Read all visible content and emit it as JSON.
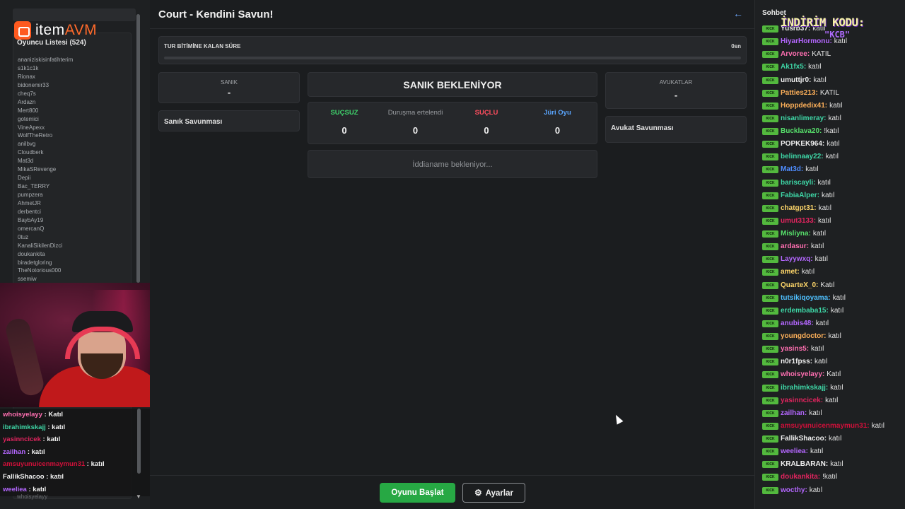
{
  "sidebar": {
    "logo_prefix": "item",
    "logo_suffix": "AVM",
    "player_list_title": "Oyuncu Listesi (524)",
    "players": [
      "ananiziskisinfatihterim",
      "s1k1c1k",
      "Rionax",
      "bidonemir33",
      "cheq7s",
      "Ardazn",
      "Mert800",
      "gotemici",
      "VineApexx",
      "WolfTheRetro",
      "anilbvg",
      "Cloudberk",
      "Mat3d",
      "MikaSRevenge",
      "Depii",
      "Bac_TERRY",
      "pumpzera",
      "AhmetJR",
      "derbentci",
      "BaybAy19",
      "omercanQ",
      "0tuz",
      "KanaliSikilenDizci",
      "doukankita",
      "biradetgloring",
      "TheNotorious000",
      "ssemiw"
    ]
  },
  "overlay_chat": {
    "rows": [
      {
        "user": "whoisyelayy",
        "color": "#ff6fb1",
        "msg": " : Katıl"
      },
      {
        "user": "ibrahimkskajj",
        "color": "#3ed6a6",
        "msg": " : katıl"
      },
      {
        "user": "yasinncicek",
        "color": "#e0245e",
        "msg": " : katıl"
      },
      {
        "user": "zailhan",
        "color": "#b467ff",
        "msg": " : katıl"
      },
      {
        "user": "amsuyunuicenmaymun31",
        "color": "#d0103a",
        "msg": " : katıl"
      },
      {
        "user": "FallikShacoo",
        "color": "#f3f3f3",
        "msg": " : katıl"
      },
      {
        "user": "weeliea",
        "color": "#b467ff",
        "msg": " : katıl"
      }
    ],
    "ghost_bottom": "whoisyelayy"
  },
  "main": {
    "title": "Court - Kendini Savun!",
    "timer_label": "TUR BİTİMİNE KALAN SÜRE",
    "timer_value": "0sn",
    "timer_progress": 0,
    "defendant_label": "SANIK",
    "defendant_value": "-",
    "defendant_defense": "Sanık Savunması",
    "status": "SANIK BEKLENİYOR",
    "votes": [
      {
        "label": "SUÇSUZ",
        "value": "0",
        "color": "#3fd16b"
      },
      {
        "label": "Duruşma ertelendi",
        "value": "0",
        "color": "#9a9da1"
      },
      {
        "label": "SUÇLU",
        "value": "0",
        "color": "#ff4d5e"
      },
      {
        "label": "Jüri Oyu",
        "value": "0",
        "color": "#5aa6ff"
      }
    ],
    "indictment_placeholder": "İddianame bekleniyor...",
    "lawyers_label": "AVUKATLAR",
    "lawyers_value": "-",
    "lawyer_defense": "Avukat Savunması",
    "start_button": "Oyunu Başlat",
    "settings_button": "Ayarlar"
  },
  "chat": {
    "title": "Sohbet",
    "badge": "KICK",
    "promo_line1": "İNDİRİM KODU:",
    "promo_line2": "\"KCB\"",
    "messages": [
      {
        "user": "Yusrb37",
        "color": "#f0f0f0",
        "text": "katıl"
      },
      {
        "user": "HiyarHormonu",
        "color": "#b467ff",
        "text": "katıl"
      },
      {
        "user": "Arvoree",
        "color": "#ff6fb1",
        "text": "KATIL"
      },
      {
        "user": "Ak1fx5",
        "color": "#3ed6a6",
        "text": "katıl"
      },
      {
        "user": "umuttjr0",
        "color": "#f0f0f0",
        "text": "katıl"
      },
      {
        "user": "Patties213",
        "color": "#ffb15a",
        "text": "KATIL"
      },
      {
        "user": "Hoppdedix41",
        "color": "#ffb15a",
        "text": "katıl"
      },
      {
        "user": "nisanlimeray",
        "color": "#3ed6a6",
        "text": "katıl"
      },
      {
        "user": "Bucklava20",
        "color": "#57e06b",
        "text": "!katıl"
      },
      {
        "user": "POPKEK964",
        "color": "#f0f0f0",
        "text": "katıl"
      },
      {
        "user": "belinnaay22",
        "color": "#3ed6a6",
        "text": "katıl"
      },
      {
        "user": "Mat3d",
        "color": "#4f8dff",
        "text": "katıl"
      },
      {
        "user": "bariscayli",
        "color": "#3ed6a6",
        "text": "katıl"
      },
      {
        "user": "FabiaAlper",
        "color": "#3ed6a6",
        "text": "katıl"
      },
      {
        "user": "chatgpt31",
        "color": "#ffd76a",
        "text": "katıl"
      },
      {
        "user": "umut3133",
        "color": "#e0245e",
        "text": "katıl"
      },
      {
        "user": "Misliyna",
        "color": "#57e06b",
        "text": "katıl"
      },
      {
        "user": "ardasur",
        "color": "#ff6fb1",
        "text": "katıl"
      },
      {
        "user": "Layywxq",
        "color": "#b467ff",
        "text": "katıl"
      },
      {
        "user": "amet",
        "color": "#ffd76a",
        "text": "katıl"
      },
      {
        "user": "QuarteX_0",
        "color": "#ffd76a",
        "text": "Katıl"
      },
      {
        "user": "tutsikiqoyama",
        "color": "#4fc0ff",
        "text": "katıl"
      },
      {
        "user": "erdembaba15",
        "color": "#3ed6a6",
        "text": "katıl"
      },
      {
        "user": "anubis48",
        "color": "#b467ff",
        "text": "katıl"
      },
      {
        "user": "youngdoctor",
        "color": "#ffb15a",
        "text": "katıl"
      },
      {
        "user": "yasins5",
        "color": "#ff6fb1",
        "text": "katıl"
      },
      {
        "user": "n0r1fpss",
        "color": "#f0f0f0",
        "text": "katıl"
      },
      {
        "user": "whoisyelayy",
        "color": "#ff6fb1",
        "text": "Katıl"
      },
      {
        "user": "ibrahimkskajj",
        "color": "#3ed6a6",
        "text": "katıl"
      },
      {
        "user": "yasinncicek",
        "color": "#e0245e",
        "text": "katıl"
      },
      {
        "user": "zailhan",
        "color": "#b467ff",
        "text": "katıl"
      },
      {
        "user": "amsuyunuicenmaymun31",
        "color": "#d0103a",
        "text": "katıl"
      },
      {
        "user": "FallikShacoo",
        "color": "#f0f0f0",
        "text": "katıl"
      },
      {
        "user": "weeliea",
        "color": "#b467ff",
        "text": "katıl"
      },
      {
        "user": "KRALBARAN",
        "color": "#f0f0f0",
        "text": "katıl"
      },
      {
        "user": "doukankita",
        "color": "#e0245e",
        "text": "!katıl"
      },
      {
        "user": "wocthy",
        "color": "#b467ff",
        "text": "katıl"
      }
    ]
  }
}
